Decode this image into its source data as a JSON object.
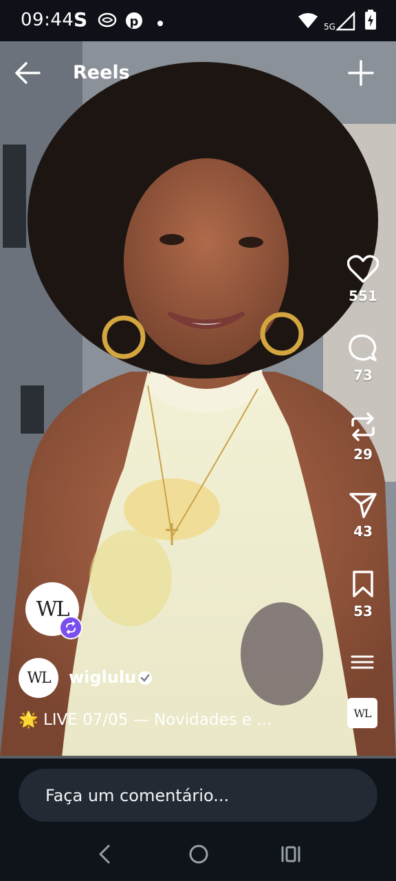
{
  "status_bar": {
    "time": "09:44",
    "app_letter": "S",
    "icons": [
      "threads-icon",
      "pinterest-icon",
      "dot-icon",
      "wifi-icon",
      "5g-signal-icon",
      "battery-charging-icon"
    ],
    "network": "5G"
  },
  "header": {
    "title": "Reels",
    "back_icon": "back-arrow-icon",
    "create_icon": "plus-icon"
  },
  "actions": {
    "likes": "551",
    "comments": "73",
    "reposts": "29",
    "shares": "43",
    "saves": "53"
  },
  "post": {
    "collab_avatar_text": "WL",
    "author_avatar_text": "WL",
    "username": "wiglulu",
    "caption": "🌟 LIVE 07/05 — Novidades e ...",
    "audio_thumb_text": "WL"
  },
  "comment": {
    "placeholder": "Faça um comentário..."
  },
  "colors": {
    "app_background": "#0f141b",
    "comment_field": "#232a33",
    "remix_badge": "#7b4ef0",
    "verified": "#ffffff"
  }
}
